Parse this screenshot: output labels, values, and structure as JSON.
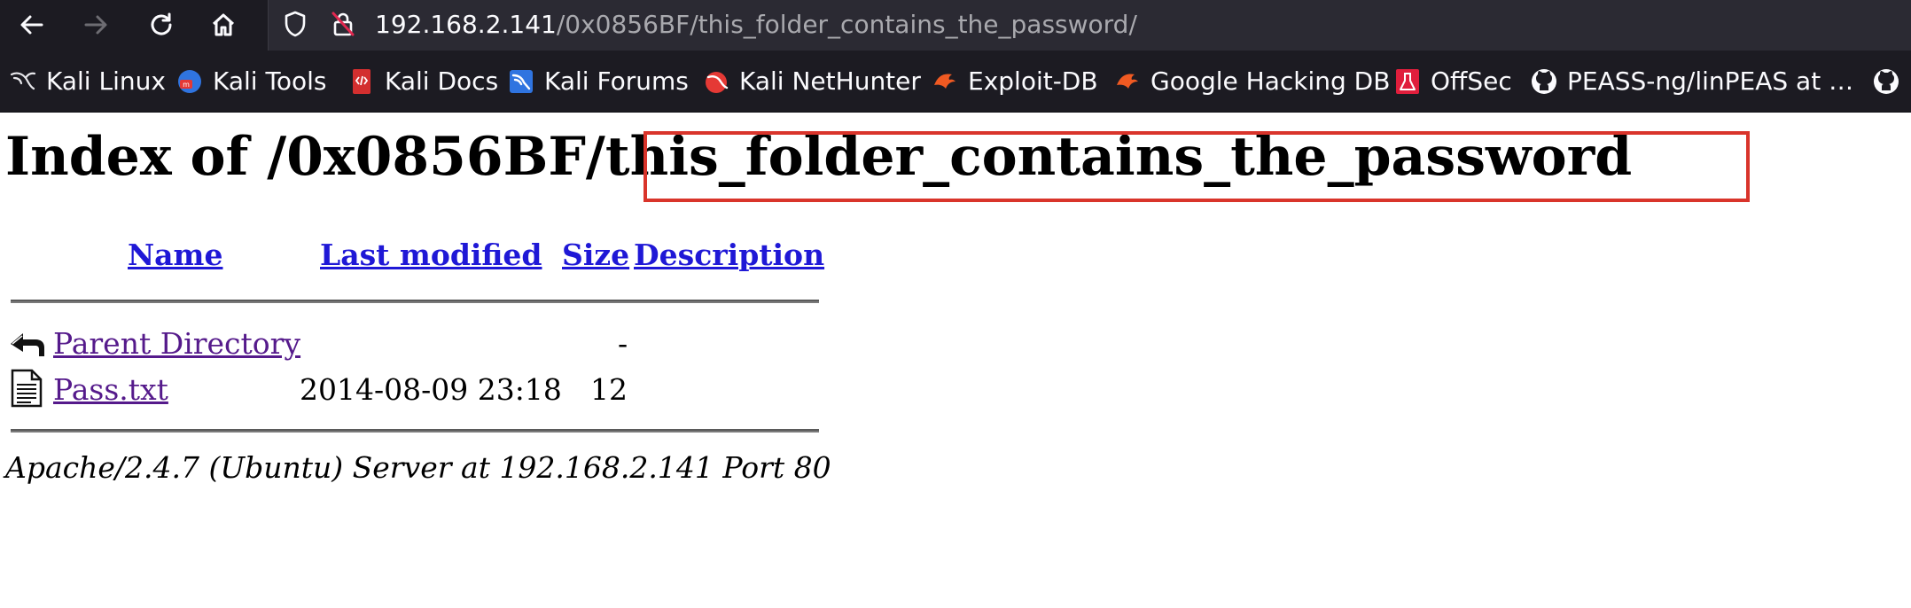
{
  "browser": {
    "url_host": "192.168.2.141",
    "url_path": "/0x0856BF/this_folder_contains_the_password/",
    "bookmarks": [
      {
        "label": "Kali Linux",
        "icon": "kali-dragon-icon"
      },
      {
        "label": "Kali Tools",
        "icon": "kali-tools-icon"
      },
      {
        "label": "Kali Docs",
        "icon": "kali-docs-icon"
      },
      {
        "label": "Kali Forums",
        "icon": "kali-forums-icon"
      },
      {
        "label": "Kali NetHunter",
        "icon": "kali-nethunter-icon"
      },
      {
        "label": "Exploit-DB",
        "icon": "exploit-db-icon"
      },
      {
        "label": "Google Hacking DB",
        "icon": "ghdb-icon"
      },
      {
        "label": "OffSec",
        "icon": "offsec-icon"
      },
      {
        "label": "PEASS-ng/linPEAS at …",
        "icon": "github-icon"
      }
    ]
  },
  "page": {
    "title_prefix": "Index of /0x0856BF/",
    "title_highlight": "this_folder_contains_the_password",
    "columns": {
      "name": "Name",
      "last_modified": "Last modified",
      "size": "Size",
      "description": "Description"
    },
    "rows": [
      {
        "name": "Parent Directory",
        "modified": "",
        "size": "-",
        "icon": "back-arrow-icon"
      },
      {
        "name": "Pass.txt",
        "modified": "2014-08-09 23:18",
        "size": "12",
        "icon": "text-file-icon"
      }
    ],
    "footer": "Apache/2.4.7 (Ubuntu) Server at 192.168.2.141 Port 80"
  },
  "colors": {
    "toolbar_bg": "#1c1b22",
    "urlbar_bg": "#2b2a33",
    "highlight_border": "#d9342b",
    "link": "#1f18d6",
    "visited_link": "#551a8b"
  }
}
